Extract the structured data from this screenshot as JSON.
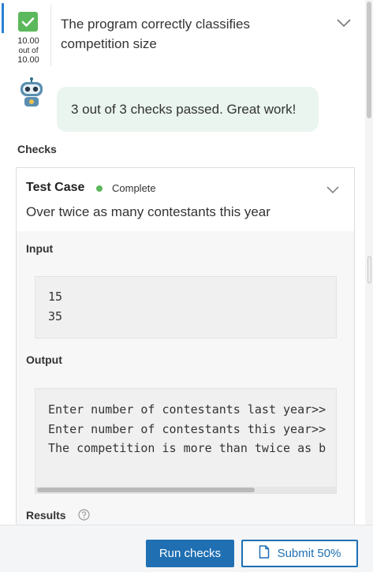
{
  "task": {
    "title_line1": "The program correctly classifies",
    "title_line2": "competition size",
    "score_value": "10.00",
    "score_out_of": "out of",
    "score_max": "10.00",
    "status_color": "#5cb85c"
  },
  "bot": {
    "avatar_icon": "robot-icon",
    "message": "3 out of 3 checks passed. Great work!"
  },
  "checks": {
    "heading": "Checks",
    "test_case": {
      "title": "Test Case",
      "status": "Complete",
      "description": "Over twice as many contestants this year",
      "input_label": "Input",
      "input_lines": [
        "15",
        "35"
      ],
      "output_label": "Output",
      "output_lines": [
        "Enter number of contestants last year>>",
        "Enter number of contestants this year>>",
        "The competition is more than twice as b"
      ]
    },
    "results_label": "Results"
  },
  "footer": {
    "run_label": "Run checks",
    "submit_label": "Submit 50%"
  },
  "colors": {
    "accent": "#1f6fb2",
    "success": "#5cb85c",
    "bubble": "#eaf5ef"
  }
}
